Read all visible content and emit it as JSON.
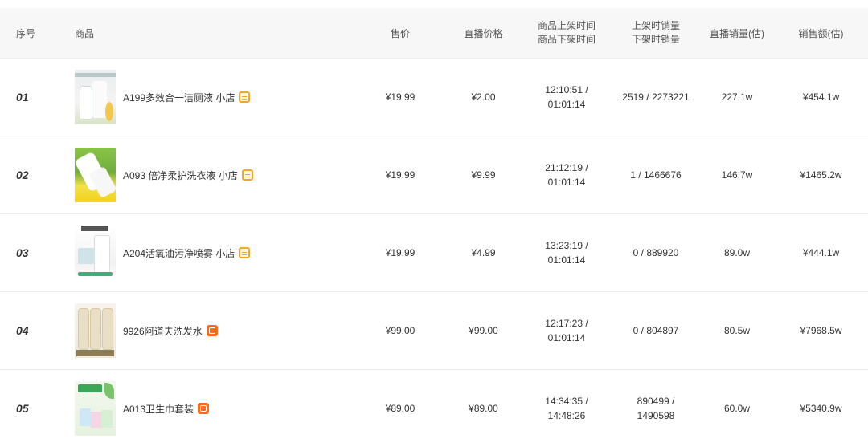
{
  "header": {
    "index": "序号",
    "product": "商品",
    "price": "售价",
    "live_price": "直播价格",
    "shelf_time_line1": "商品上架时间",
    "shelf_time_line2": "商品下架时间",
    "sales_line1": "上架时销量",
    "sales_line2": "下架时销量",
    "live_volume": "直播销量(估)",
    "revenue": "销售额(估)"
  },
  "rows": [
    {
      "index": "01",
      "name": "A199多效合一洁厕液 小店",
      "badge": "shop-icon",
      "price": "¥19.99",
      "live_price": "¥2.00",
      "time_on": "12:10:51 /",
      "time_off": "01:01:14",
      "sales_on": "2519 / 2273221",
      "sales_off": "",
      "volume": "227.1w",
      "revenue": "¥454.1w"
    },
    {
      "index": "02",
      "name": "A093 倍净柔护洗衣液 小店",
      "badge": "shop-icon",
      "price": "¥19.99",
      "live_price": "¥9.99",
      "time_on": "21:12:19 /",
      "time_off": "01:01:14",
      "sales_on": "1 / 1466676",
      "sales_off": "",
      "volume": "146.7w",
      "revenue": "¥1465.2w"
    },
    {
      "index": "03",
      "name": "A204活氧油污净喷雾 小店",
      "badge": "shop-icon",
      "price": "¥19.99",
      "live_price": "¥4.99",
      "time_on": "13:23:19 /",
      "time_off": "01:01:14",
      "sales_on": "0 / 889920",
      "sales_off": "",
      "volume": "89.0w",
      "revenue": "¥444.1w"
    },
    {
      "index": "04",
      "name": "9926阿道夫洗发水",
      "badge": "taobao-icon",
      "price": "¥99.00",
      "live_price": "¥99.00",
      "time_on": "12:17:23 /",
      "time_off": "01:01:14",
      "sales_on": "0 / 804897",
      "sales_off": "",
      "volume": "80.5w",
      "revenue": "¥7968.5w"
    },
    {
      "index": "05",
      "name": "A013卫生巾套装",
      "badge": "taobao-icon",
      "price": "¥89.00",
      "live_price": "¥89.00",
      "time_on": "14:34:35 /",
      "time_off": "14:48:26",
      "sales_on": "890499 /",
      "sales_off": "1490598",
      "volume": "60.0w",
      "revenue": "¥5340.9w"
    }
  ],
  "colors": {
    "header_bg": "#f7f7f7",
    "shop_badge": "#f5a623",
    "taobao_badge": "#ff6a1a"
  }
}
